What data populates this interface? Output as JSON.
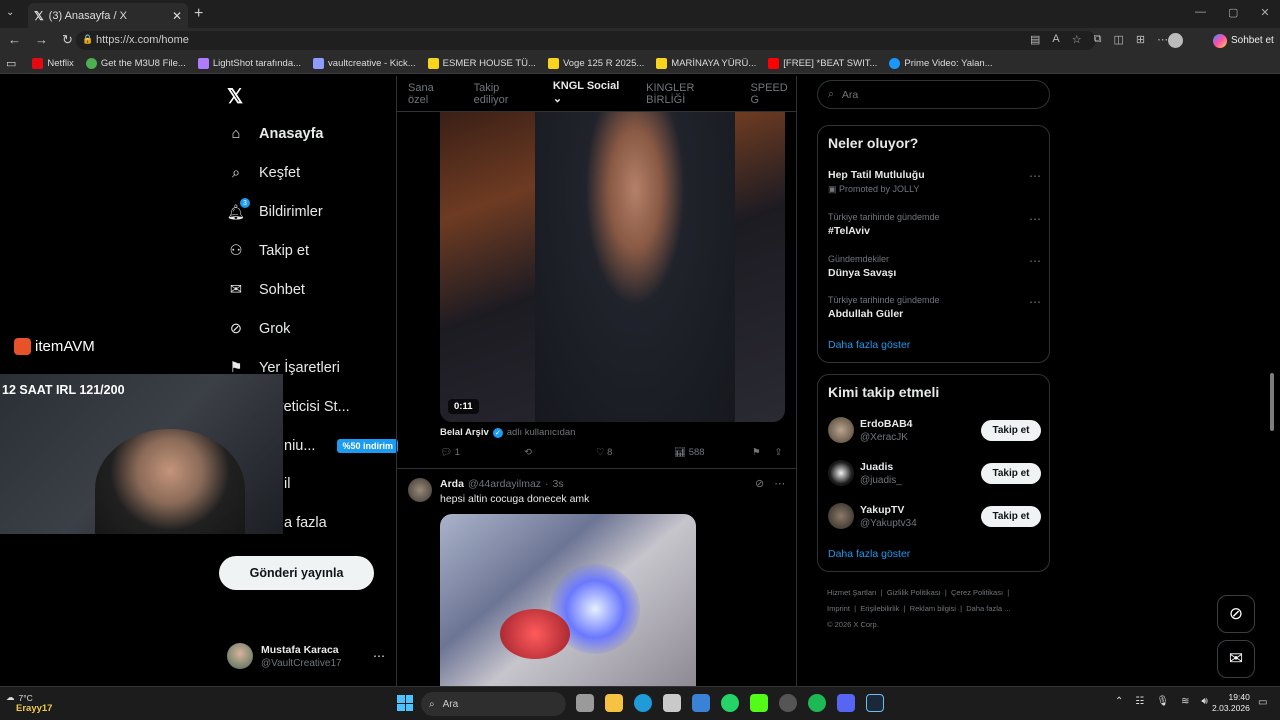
{
  "browser": {
    "tab_title": "(3) Anasayfa / X",
    "url": "https://x.com/home",
    "chat_label": "Sohbet et",
    "bookmarks": [
      "Netflix",
      "Get the M3U8 File...",
      "LightShot tarafında...",
      "vaultcreative - Kick...",
      "ESMER HOUSE TÜ...",
      "Voge 125 R 2025...",
      "MARİNAYA YÜRÜ...",
      "[FREE] *BEAT SWIT...",
      "Prime Video: Yalan..."
    ]
  },
  "nav": {
    "home": "Anasayfa",
    "explore": "Keşfet",
    "notifications": "Bildirimler",
    "notif_count": "3",
    "follow": "Takip et",
    "chat": "Sohbet",
    "grok": "Grok",
    "bookmarks": "Yer İşaretleri",
    "creator": "k Üreticisi St...",
    "premium": "niu...",
    "premium_badge": "%50 indirim",
    "profile": "il",
    "more": "a fazla",
    "post_button": "Gönderi yayınla",
    "user_name": "Mustafa Karaca",
    "user_handle": "@VaultCreative17"
  },
  "overlay": {
    "brand": "itemAVM",
    "stream_title": "12 SAAT IRL 121/200"
  },
  "timeline": {
    "tabs": [
      "Sana özel",
      "Takip ediliyor",
      "KNGL Social",
      "KINGLER BİRLİĞİ",
      "SPEED G"
    ],
    "post1": {
      "video_time": "0:11",
      "author": "Belal Arşiv",
      "subtitle": "adlı kullanıcıdan",
      "replies": "1",
      "likes": "8",
      "views": "588"
    },
    "post2": {
      "author": "Arda",
      "handle": "@44ardayilmaz",
      "time": "3s",
      "text": "hepsi altin cocuga donecek amk"
    }
  },
  "right": {
    "search_placeholder": "Ara",
    "trends_title": "Neler oluyor?",
    "trends": [
      {
        "context": "",
        "name": "Hep Tatil Mutluluğu",
        "sub": "Promoted by JOLLY"
      },
      {
        "context": "Türkiye tarihinde gündemde",
        "name": "#TelAviv",
        "sub": ""
      },
      {
        "context": "Gündemdekiler",
        "name": "Dünya Savaşı",
        "sub": ""
      },
      {
        "context": "Türkiye tarihinde gündemde",
        "name": "Abdullah Güler",
        "sub": ""
      }
    ],
    "show_more": "Daha fazla göster",
    "who_title": "Kimi takip etmeli",
    "who": [
      {
        "name": "ErdoBAB4",
        "handle": "@XeracJK"
      },
      {
        "name": "Juadis",
        "handle": "@juadis_"
      },
      {
        "name": "YakupTV",
        "handle": "@Yakuptv34"
      }
    ],
    "follow_label": "Takip et",
    "footer": [
      "Hizmet Şartları",
      "Gizlilik Politikası",
      "Çerez Politikası",
      "Imprint",
      "Erişilebilirlik",
      "Reklam bilgisi",
      "Daha fazla ...",
      "© 2026 X Corp."
    ]
  },
  "taskbar": {
    "weather": "7°C",
    "search": "Ara",
    "time": "19:40",
    "date": "2.03.2026",
    "streamer": "Erayy17"
  },
  "colors": {
    "accent": "#1d9bf0",
    "bg": "#000000",
    "verified": "#1d9bf0",
    "premium_badge": "#1d9bf0"
  }
}
